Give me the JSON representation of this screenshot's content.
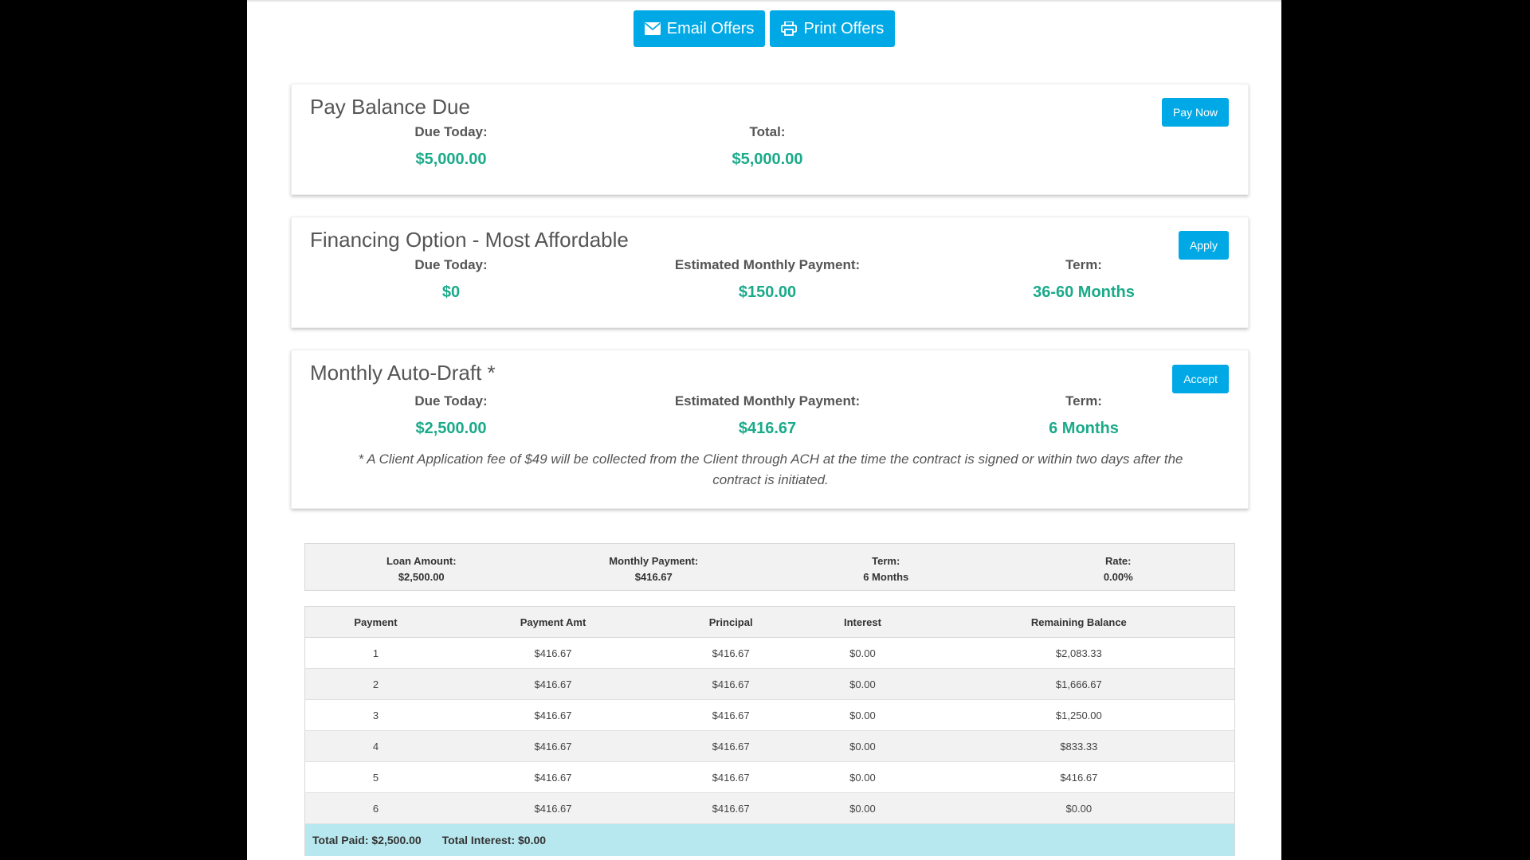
{
  "top_actions": {
    "email_label": "Email Offers",
    "print_label": "Print Offers",
    "email_icon": "envelope-icon",
    "print_icon": "printer-icon",
    "accent_color": "#00a9e6"
  },
  "offers": [
    {
      "title": "Pay Balance Due",
      "button": "Pay Now",
      "metrics": [
        {
          "label": "Due Today:",
          "value": "$5,000.00"
        },
        {
          "label": "Total:",
          "value": "$5,000.00"
        }
      ]
    },
    {
      "title": "Financing Option - Most Affordable",
      "button": "Apply",
      "metrics": [
        {
          "label": "Due Today:",
          "value": "$0"
        },
        {
          "label": "Estimated Monthly Payment:",
          "value": "$150.00"
        },
        {
          "label": "Term:",
          "value": "36-60 Months"
        }
      ]
    },
    {
      "title": "Monthly Auto-Draft *",
      "button": "Accept",
      "metrics": [
        {
          "label": "Due Today:",
          "value": "$2,500.00"
        },
        {
          "label": "Estimated Monthly Payment:",
          "value": "$416.67"
        },
        {
          "label": "Term:",
          "value": "6 Months"
        }
      ],
      "note": "* A Client Application fee of $49 will be collected from the Client through ACH at the time the contract is signed or within two days after the contract is initiated."
    }
  ],
  "loan_summary": [
    {
      "label": "Loan Amount:",
      "value": "$2,500.00"
    },
    {
      "label": "Monthly Payment:",
      "value": "$416.67"
    },
    {
      "label": "Term:",
      "value": "6 Months"
    },
    {
      "label": "Rate:",
      "value": "0.00%"
    }
  ],
  "amortization": {
    "headers": [
      "Payment",
      "Payment Amt",
      "Principal",
      "Interest",
      "Remaining Balance"
    ],
    "rows": [
      [
        "1",
        "$416.67",
        "$416.67",
        "$0.00",
        "$2,083.33"
      ],
      [
        "2",
        "$416.67",
        "$416.67",
        "$0.00",
        "$1,666.67"
      ],
      [
        "3",
        "$416.67",
        "$416.67",
        "$0.00",
        "$1,250.00"
      ],
      [
        "4",
        "$416.67",
        "$416.67",
        "$0.00",
        "$833.33"
      ],
      [
        "5",
        "$416.67",
        "$416.67",
        "$0.00",
        "$416.67"
      ],
      [
        "6",
        "$416.67",
        "$416.67",
        "$0.00",
        "$0.00"
      ]
    ],
    "totals": {
      "total_paid": "Total Paid: $2,500.00",
      "total_interest": "Total Interest: $0.00"
    }
  },
  "colors": {
    "value_green": "#1aaa8a",
    "totals_row_bg": "#b8e8ef"
  }
}
